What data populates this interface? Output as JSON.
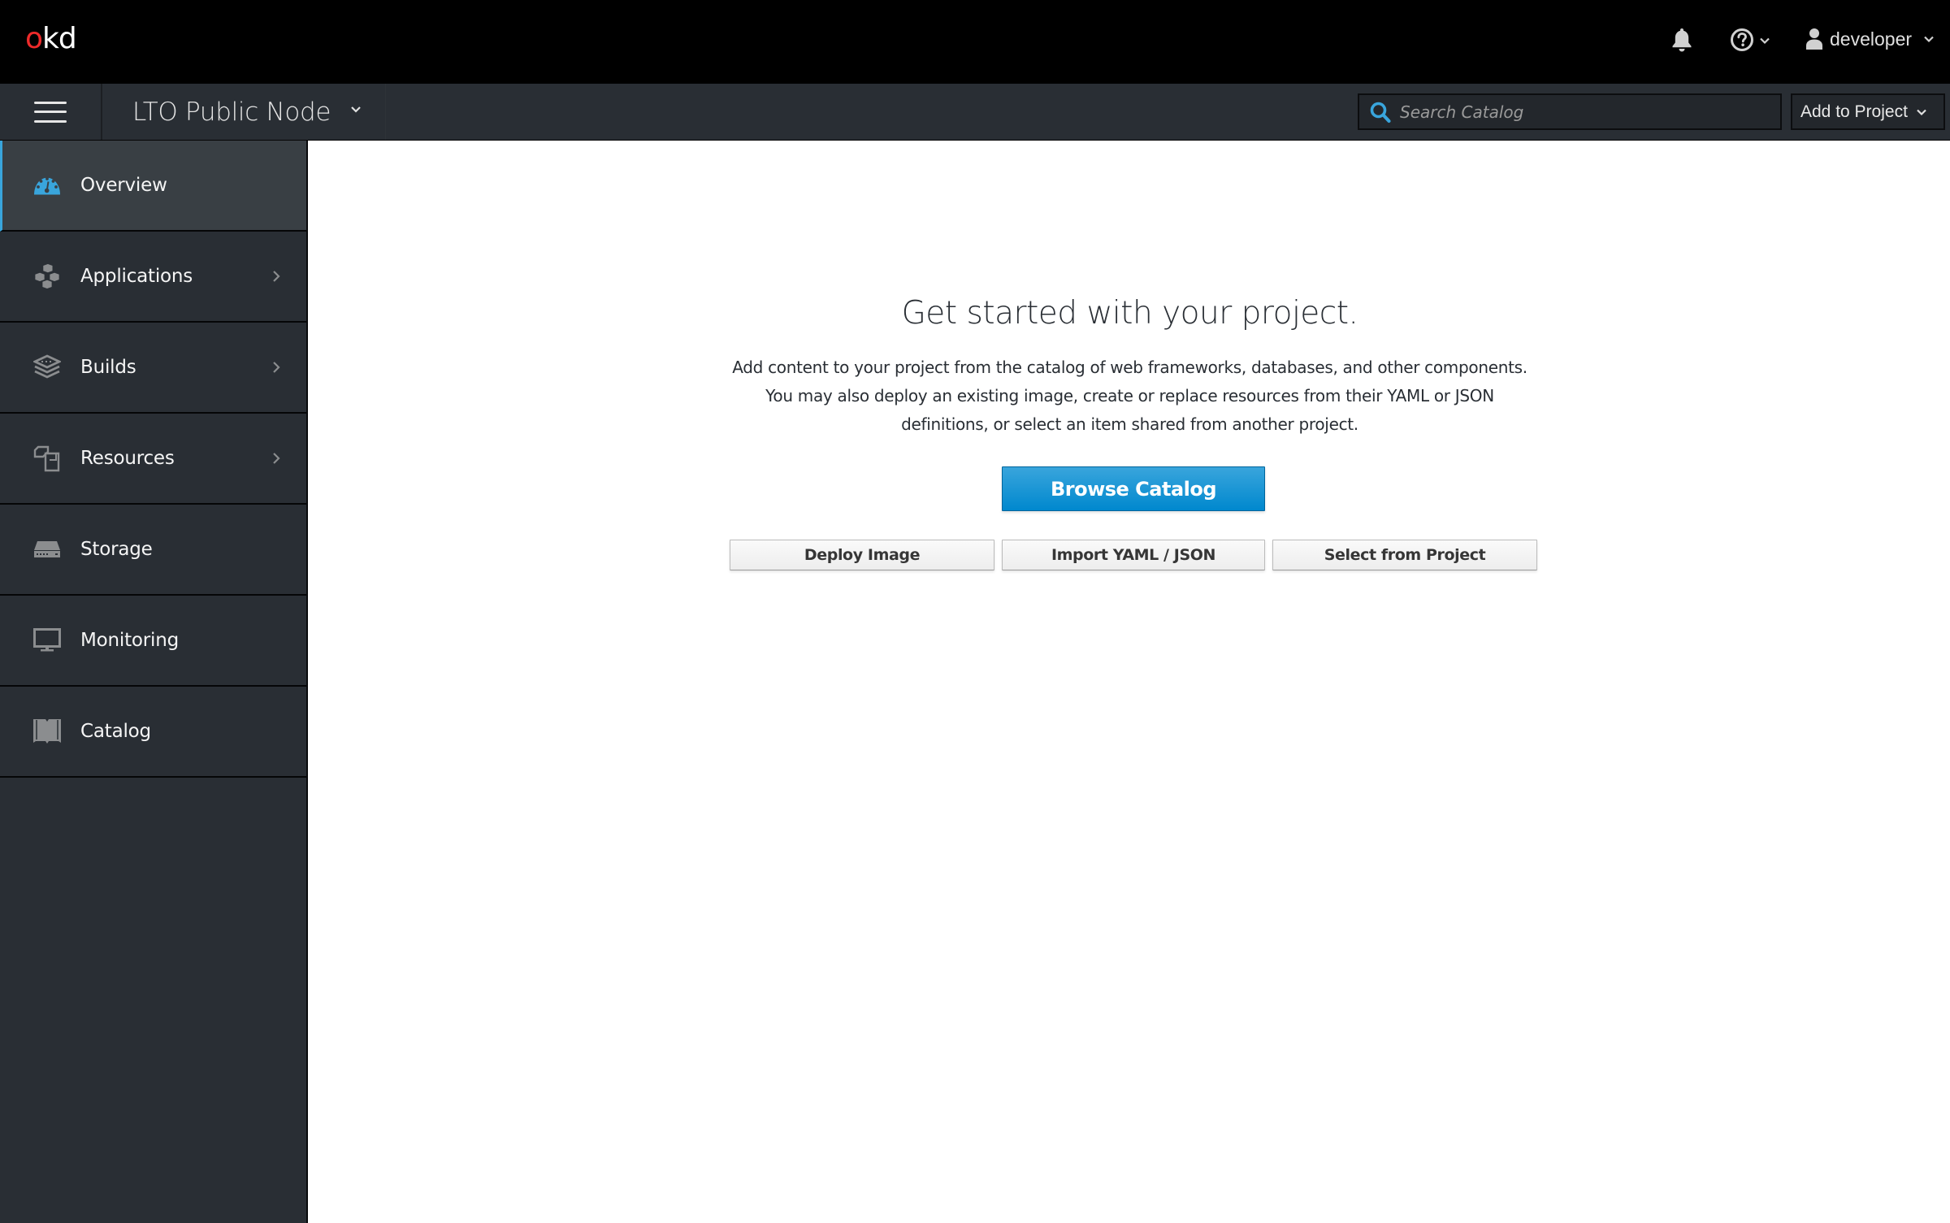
{
  "masthead": {
    "logo_prefix": "o",
    "logo_suffix": "kd",
    "brand_color": "#ee2a2a",
    "notifications_icon": "bell-icon",
    "help_icon": "question-circle-icon",
    "user": {
      "icon": "user-icon",
      "name": "developer"
    }
  },
  "subbar": {
    "menu_icon": "hamburger-icon",
    "project_name": "LTO Public Node",
    "search": {
      "placeholder": "Search Catalog",
      "value": "",
      "icon": "search-icon"
    },
    "add_to_project_label": "Add to Project"
  },
  "sidebar": {
    "accent_color": "#39a5dc",
    "items": [
      {
        "label": "Overview",
        "icon": "dashboard-icon",
        "active": true,
        "has_submenu": false
      },
      {
        "label": "Applications",
        "icon": "cubes-icon",
        "active": false,
        "has_submenu": true
      },
      {
        "label": "Builds",
        "icon": "layers-icon",
        "active": false,
        "has_submenu": true
      },
      {
        "label": "Resources",
        "icon": "files-icon",
        "active": false,
        "has_submenu": true
      },
      {
        "label": "Storage",
        "icon": "storage-drive-icon",
        "active": false,
        "has_submenu": false
      },
      {
        "label": "Monitoring",
        "icon": "monitor-icon",
        "active": false,
        "has_submenu": false
      },
      {
        "label": "Catalog",
        "icon": "book-icon",
        "active": false,
        "has_submenu": false
      }
    ]
  },
  "main": {
    "title": "Get started with your project.",
    "description": "Add content to your project from the catalog of web frameworks, databases, and other components. You may also deploy an existing image, create or replace resources from their YAML or JSON definitions, or select an item shared from another project.",
    "primary_button": "Browse Catalog",
    "secondary_buttons": [
      "Deploy Image",
      "Import YAML / JSON",
      "Select from Project"
    ]
  }
}
